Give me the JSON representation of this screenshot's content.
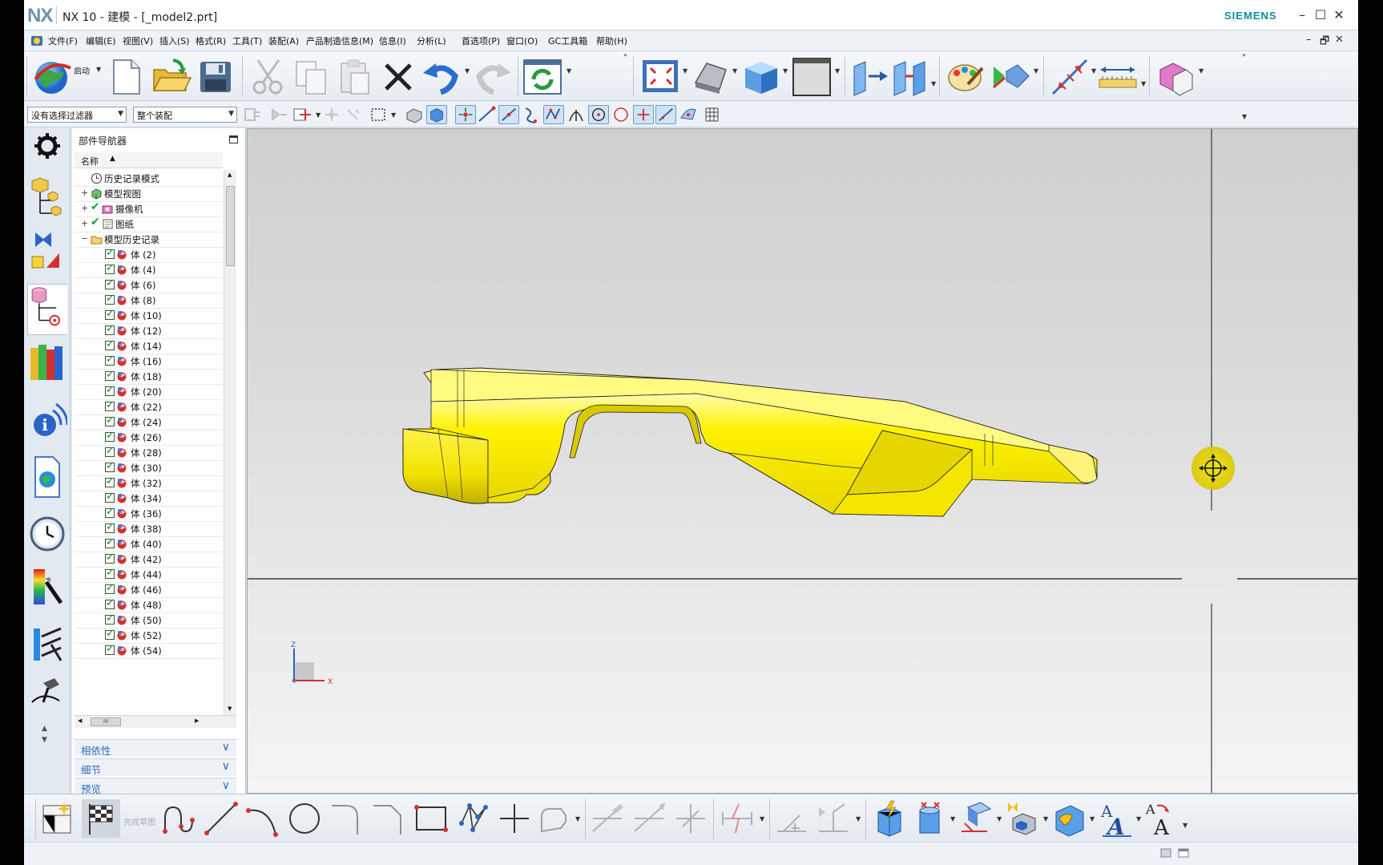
{
  "window": {
    "logo": "NX",
    "title": "NX 10 - 建模 - [_model2.prt]",
    "brand": "SIEMENS",
    "controls": {
      "minimize": "–",
      "restore": "☐",
      "close": "✕"
    },
    "doc_controls": {
      "minimize": "–",
      "restore": "🗗",
      "close": "✕"
    }
  },
  "menubar": {
    "items": [
      "文件(F)",
      "编辑(E)",
      "视图(V)",
      "插入(S)",
      "格式(R)",
      "工具(T)",
      "装配(A)",
      "产品制造信息(M)",
      "信息(I)",
      "分析(L)",
      "首选项(P)",
      "窗口(O)",
      "GC工具箱",
      "帮助(H)"
    ]
  },
  "toolbar_main": {
    "start_label": "启动",
    "overflow": "»"
  },
  "selection_bar": {
    "type_filter": "没有选择过滤器",
    "scope": "整个装配"
  },
  "navigator": {
    "title": "部件导航器",
    "column_header": "名称",
    "sort_indicator": "▲",
    "top_rows": [
      {
        "label": "历史记录模式"
      },
      {
        "label": "模型视图"
      },
      {
        "label": "摄像机"
      },
      {
        "label": "图纸"
      },
      {
        "label": "模型历史记录"
      }
    ],
    "features": [
      "体 (2)",
      "体 (4)",
      "体 (6)",
      "体 (8)",
      "体 (10)",
      "体 (12)",
      "体 (14)",
      "体 (16)",
      "体 (18)",
      "体 (20)",
      "体 (22)",
      "体 (24)",
      "体 (26)",
      "体 (28)",
      "体 (30)",
      "体 (32)",
      "体 (34)",
      "体 (36)",
      "体 (38)",
      "体 (40)",
      "体 (42)",
      "体 (44)",
      "体 (46)",
      "体 (48)",
      "体 (50)",
      "体 (52)",
      "体 (54)"
    ],
    "panels": [
      "相依性",
      "细节",
      "预览"
    ],
    "hscroll_grip": "III"
  },
  "viewport": {
    "triad_x": "X",
    "triad_z": "Z",
    "model_color": "#f7e900"
  },
  "toolbar_bottom": {
    "finish_sketch_label": "完成草图"
  },
  "colors": {
    "accent": "#2c6bc0",
    "brand": "#0f8c9a",
    "model": "#f7e900"
  }
}
